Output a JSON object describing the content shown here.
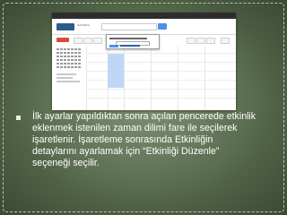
{
  "screenshot": {
    "logo_text": "SAKARYA",
    "popup_date": "Per, 13 Eylül 2012, 10:00 - 11:00"
  },
  "slide": {
    "bullet_lines": [
      "İlk ayarlar yapıldıktan sonra açılan pencerede etkinlik",
      "eklenmek istenilen zaman dilimi fare ile seçilerek",
      "işaretlenir. İşaretleme sonrasında Etkinliğin",
      "detaylarını ayarlamak için “Etkinliği Düzenle”",
      "seçeneği seçilir."
    ]
  }
}
